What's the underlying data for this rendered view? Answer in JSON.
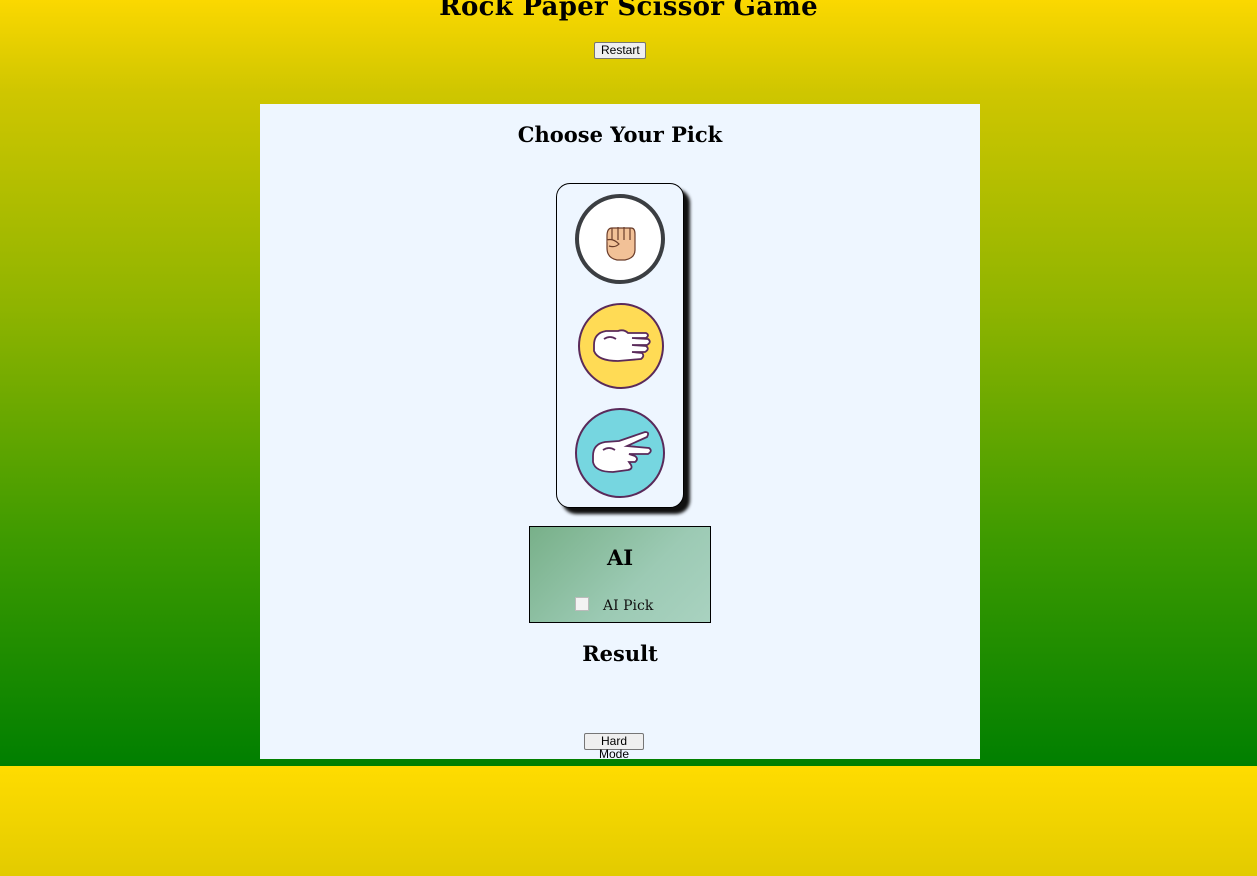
{
  "header": {
    "title": "Rock Paper Scissor Game",
    "restart_label": "Restart"
  },
  "game": {
    "choose_heading": "Choose Your Pick",
    "picks": [
      {
        "name": "rock",
        "icon": "rock-fist-icon",
        "bg": "#ffffff"
      },
      {
        "name": "paper",
        "icon": "paper-hand-icon",
        "bg": "#ffdb55"
      },
      {
        "name": "scissors",
        "icon": "scissors-hand-icon",
        "bg": "#76d6e0"
      }
    ],
    "ai": {
      "label": "AI",
      "pick_alt": "AI Pick"
    },
    "result_label": "Result",
    "hard_mode_label": "Hard Mode"
  },
  "colors": {
    "gradient_top": "#ffde00",
    "gradient_bottom": "#007f00",
    "panel_bg": "#eef6ff"
  }
}
